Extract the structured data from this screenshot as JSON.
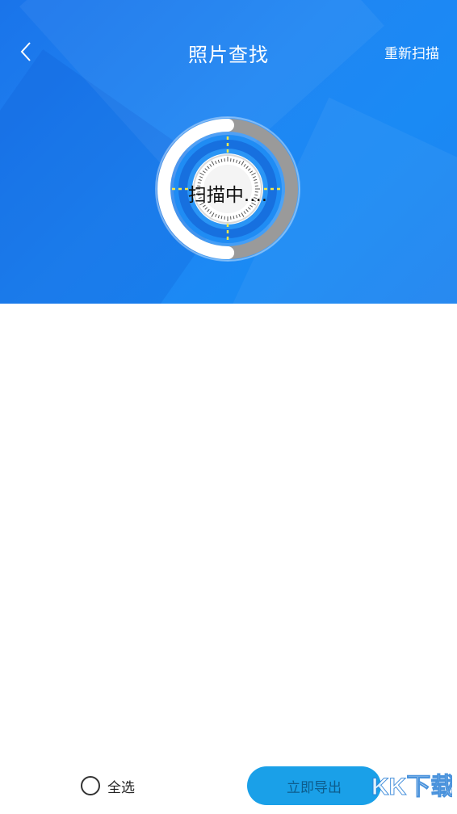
{
  "header": {
    "title": "照片查找",
    "rescan_label": "重新扫描",
    "back_icon": "chevron-left-icon"
  },
  "scanner": {
    "status_text": "扫描中....",
    "progress": 0.5
  },
  "footer": {
    "select_all_label": "全选",
    "export_label": "立即导出"
  },
  "watermark": {
    "text": "KK下载",
    "url": "www.kkx.net"
  },
  "colors": {
    "hero_blue": "#1a80f0",
    "progress_white": "#ffffff",
    "track_gray": "#9a9a9a",
    "dial_blue": "#1776e0",
    "crosshair_yellow": "#f5e94a",
    "export_button": "#1aa0e8"
  }
}
